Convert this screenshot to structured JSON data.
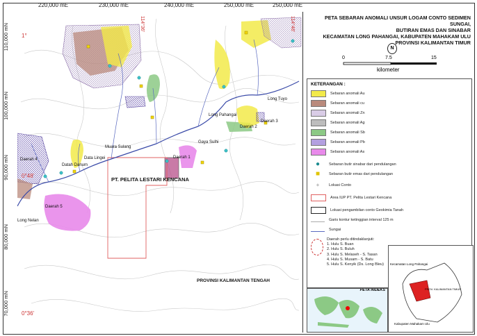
{
  "map": {
    "easting_labels": [
      "220,000 mE",
      "230,000 mE",
      "240,000 mE",
      "250,000 mE",
      "250,000 mE"
    ],
    "northing_labels": [
      "110,000 mN",
      "100,000 mN",
      "90,000 mN",
      "80,000 mN",
      "70,000 mN"
    ],
    "lat_labels": [
      "1°",
      "0°48'",
      "0°36'"
    ],
    "long_labels": [
      "114°36'",
      "114°48'"
    ],
    "concession_label": "PT. PELITA LESTARI KENCANA",
    "province_label": "PROVINSI KALIMANTAN TENGAH",
    "places": [
      "Long Tuyo",
      "Long Pahangai",
      "Daerah 2",
      "Daerah 1",
      "Daerah 3",
      "Muara Sulang",
      "Data Lingei",
      "Datah Danum",
      "Long Nelan",
      "Daerah 4",
      "Daerah 5",
      "Gaya Sulhi"
    ]
  },
  "title": {
    "line1": "PETA SEBARAN ANOMALI UNSUR LOGAM CONTO SEDIMEN SUNGAI,",
    "line2": "BUTIRAN EMAS DAN SINABAR",
    "line3": "KECAMATAN LONG PAHANGAI, KABUPATEN MAHAKAM ULU",
    "line4": "PROVINSI KALIMANTAN TIMUR"
  },
  "scale": {
    "ticks": [
      "0",
      "7.5",
      "15"
    ],
    "unit": "kilometer",
    "north": "N"
  },
  "legend": {
    "heading": "KETERANGAN :",
    "items": [
      {
        "label": "Sebaran anomali Au",
        "color": "#f2ea4a"
      },
      {
        "label": "Sebaran anomali cu",
        "color": "#b98a7c"
      },
      {
        "label": "Sebaran anomali Zn",
        "color": "#d9cce6"
      },
      {
        "label": "Sebaran anomali Ag",
        "color": "#bdbdbd"
      },
      {
        "label": "Sebaran anomali Sb",
        "color": "#8cc985"
      },
      {
        "label": "Sebaran anomali Pb",
        "color": "#b3a0e0"
      },
      {
        "label": "Sebaran anomali As",
        "color": "#e88aea"
      }
    ],
    "symbols": [
      "Sebaran butir sinabar dari pendulangan",
      "Sebaran butir emas dari pendulangan",
      "Lokasi Conto",
      "Area IUP PT. Pelita Lestari Kencana",
      "Lokasi pengambilan conto Geokimia Tanah",
      "Garis kontur ketinggian interval 125 m",
      "Sungai"
    ],
    "follow_up_heading": "Daerah perlu ditindaklanjuti:",
    "follow_up": [
      "1. Hulu S. Buan",
      "2. Hulu S. Buluh",
      "3. Hulu S. Melaseh - S. Tasan",
      "4. Hulu S. Musam - S. Batu",
      "5. Hulu S. Kenyik (Ds. Long Bleu)"
    ]
  },
  "insets": {
    "index_title": "PETA INDEKS",
    "district_labels": [
      "Kecamatan Long Pahangai",
      "PROV. KALIMANTAN TIMUR",
      "Kabupaten Mahakam Ulu"
    ]
  }
}
